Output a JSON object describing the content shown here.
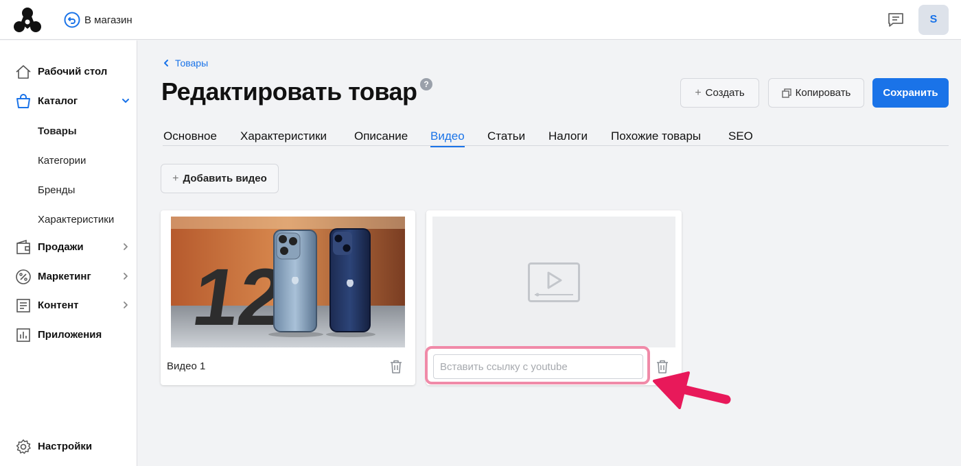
{
  "header": {
    "back_to_store": "В магазин",
    "avatar_letter": "S"
  },
  "sidebar": {
    "items": [
      {
        "label": "Рабочий стол"
      },
      {
        "label": "Каталог"
      },
      {
        "label": "Продажи"
      },
      {
        "label": "Маркетинг"
      },
      {
        "label": "Контент"
      },
      {
        "label": "Приложения"
      }
    ],
    "catalog_sub": [
      "Товары",
      "Категории",
      "Бренды",
      "Характеристики"
    ],
    "settings": "Настройки"
  },
  "main": {
    "breadcrumb": "Товары",
    "title": "Редактировать товар",
    "help": "?",
    "buttons": {
      "create": "Создать",
      "copy": "Копировать",
      "save": "Сохранить"
    },
    "tabs": [
      "Основное",
      "Характеристики",
      "Описание",
      "Видео",
      "Статьи",
      "Налоги",
      "Похожие товары",
      "SEO"
    ],
    "active_tab": "Видео",
    "add_video": "Добавить видео",
    "video_card": {
      "label": "Видео 1",
      "thumbnail_text": "12"
    },
    "new_video_card": {
      "url_placeholder": "Вставить ссылку с youtube"
    }
  },
  "colors": {
    "accent": "#1a73e8",
    "highlight": "#f08aa8",
    "arrow": "#e8195a"
  }
}
